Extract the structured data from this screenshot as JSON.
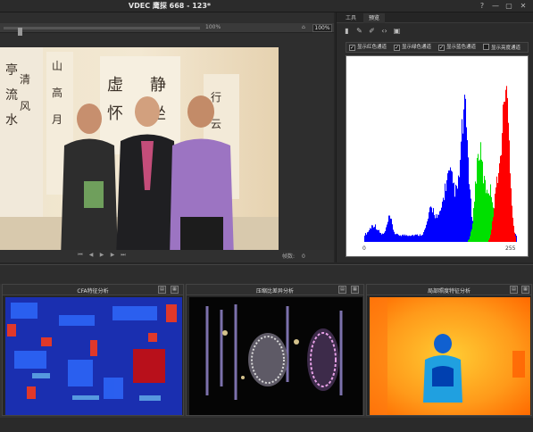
{
  "app": {
    "title": "VDEC 鹰探 668 - 123*",
    "window_controls": [
      "?",
      "—",
      "▢",
      "✕"
    ]
  },
  "viewer": {
    "zoom_left": "100%",
    "zoom_right": "100%",
    "frame_label": "帧数:",
    "frame_value": "0",
    "play_controls": [
      "first-frame",
      "prev-frame",
      "play",
      "next-frame",
      "last-frame"
    ]
  },
  "tools": {
    "tabs": [
      {
        "label": "工具",
        "active": false
      },
      {
        "label": "预览",
        "active": true
      }
    ],
    "icons": [
      "histogram-icon",
      "eyedropper-icon",
      "pencil-icon",
      "code-icon",
      "image-icon"
    ],
    "channel_checks": [
      {
        "label": "显示红色通道",
        "checked": true
      },
      {
        "label": "显示绿色通道",
        "checked": true
      },
      {
        "label": "显示蓝色通道",
        "checked": true
      },
      {
        "label": "显示亮度通道",
        "checked": false
      }
    ],
    "histogram_axis": {
      "min": "0",
      "max": "255"
    },
    "colors": {
      "red": "#ff0000",
      "green": "#00e000",
      "blue": "#0000ff"
    }
  },
  "panels": [
    {
      "title": "CFA特征分析",
      "buttons": [
        "save-icon",
        "export-icon"
      ]
    },
    {
      "title": "压缩比差异分析",
      "buttons": [
        "save-icon",
        "export-icon"
      ]
    },
    {
      "title": "局部照度特征分析",
      "buttons": [
        "save-icon",
        "export-icon"
      ]
    }
  ]
}
